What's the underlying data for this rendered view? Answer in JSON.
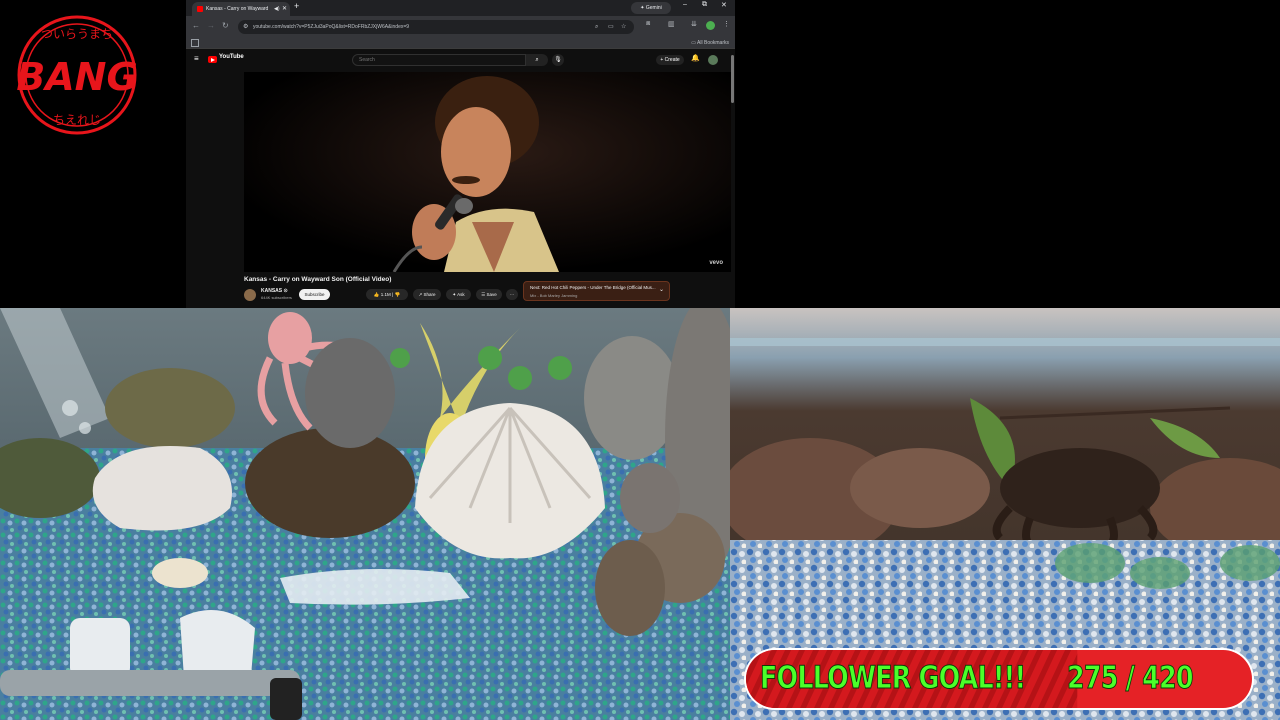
{
  "logo": {
    "text": "BANG",
    "ring_text": "ついらうまち · ちえれじ"
  },
  "browser": {
    "tab_title": "Kansas - Carry on Wayward",
    "gemini_label": "Gemini",
    "url": "youtube.com/watch?v=P5ZJui3aPoQ&list=RDoFRbZJXjW6A&index=9",
    "bookmarks_label": "All Bookmarks"
  },
  "youtube": {
    "brand": "YouTube",
    "search_placeholder": "Search",
    "create_label": "Create",
    "vevo": "vevo",
    "video_title": "Kansas - Carry on Wayward Son (Official Video)",
    "channel_name": "KANSAS ⊙",
    "channel_subs": "644K subscribers",
    "subscribe_label": "Subscribe",
    "like_count": "1.1M",
    "share_label": "Share",
    "ask_label": "Ask",
    "save_label": "Save",
    "more_label": "···",
    "up_next_title": "Next: Red Hot Chili Peppers - Under The Bridge (Official Mus...",
    "up_next_sub": "Mix - Bob Marley Jamming"
  },
  "goal": {
    "label": "FOLLOWER GOAL!!!",
    "current": 275,
    "target": 420,
    "count_text": "275 / 420"
  }
}
